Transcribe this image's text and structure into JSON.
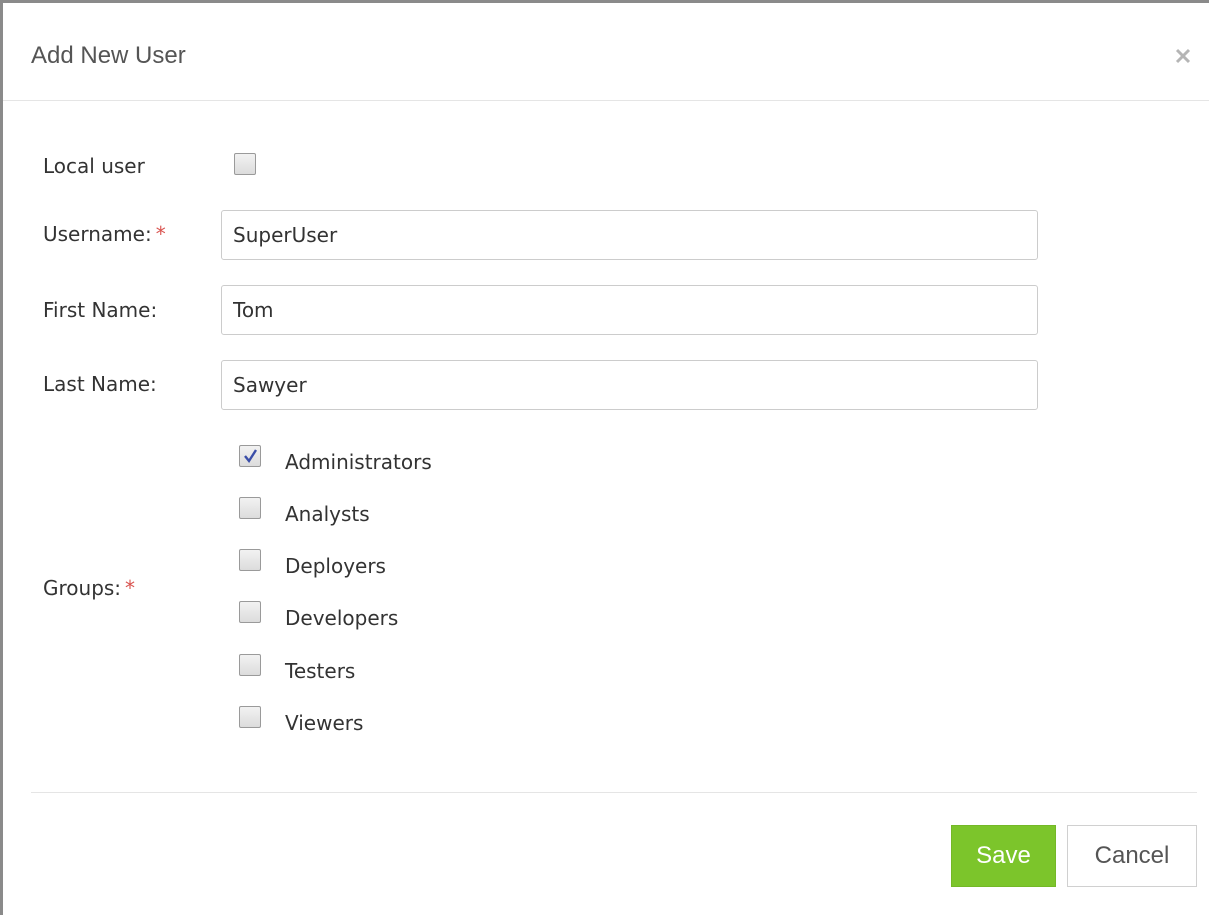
{
  "dialog": {
    "title": "Add New User"
  },
  "form": {
    "local_user_label": "Local user",
    "local_user_checked": false,
    "username_label": "Username:",
    "username_value": "SuperUser",
    "first_name_label": "First Name:",
    "first_name_value": "Tom",
    "last_name_label": "Last Name:",
    "last_name_value": "Sawyer",
    "groups_label": "Groups:",
    "required_marker": "*",
    "groups": [
      {
        "label": "Administrators",
        "checked": true
      },
      {
        "label": "Analysts",
        "checked": false
      },
      {
        "label": "Deployers",
        "checked": false
      },
      {
        "label": "Developers",
        "checked": false
      },
      {
        "label": "Testers",
        "checked": false
      },
      {
        "label": "Viewers",
        "checked": false
      }
    ]
  },
  "footer": {
    "save_label": "Save",
    "cancel_label": "Cancel"
  },
  "colors": {
    "save_button": "#7cc52b",
    "required_marker": "#d9534f",
    "check_mark": "#3a4ea8"
  },
  "icons": {
    "close": "close-icon",
    "check": "check-icon"
  }
}
